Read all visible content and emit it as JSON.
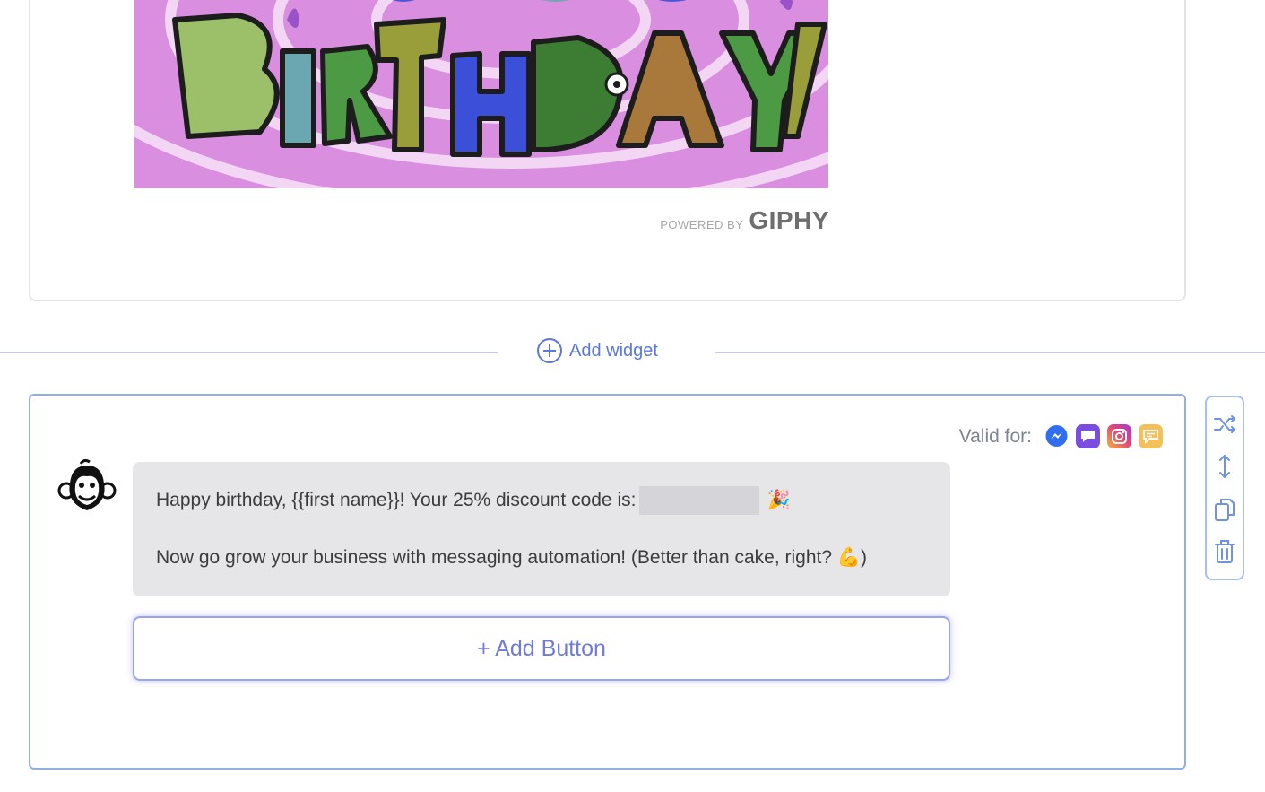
{
  "gif_card": {
    "gif_text": "BIRTHDAY!",
    "attribution_prefix": "POWERED BY",
    "attribution_brand": "GIPHY"
  },
  "add_widget": {
    "label": "Add widget"
  },
  "message_card": {
    "valid_for_label": "Valid for:",
    "channels": [
      {
        "icon": "messenger-icon",
        "color": "#2f6ef0"
      },
      {
        "icon": "sms-chat-icon",
        "color": "#7a4de0"
      },
      {
        "icon": "instagram-icon",
        "color": "#e0457a"
      },
      {
        "icon": "webchat-icon",
        "color": "#f2c15a"
      }
    ],
    "line1": "Happy birthday, {{first name}}! Your 25% discount code is:",
    "line1_emoji": "🎉",
    "line2": "Now go grow your business with messaging automation! (Better than cake, right? 💪)",
    "add_button_label": "+ Add Button"
  },
  "toolbar": {
    "tools": [
      "shuffle-icon",
      "move-icon",
      "duplicate-icon",
      "delete-icon"
    ]
  }
}
